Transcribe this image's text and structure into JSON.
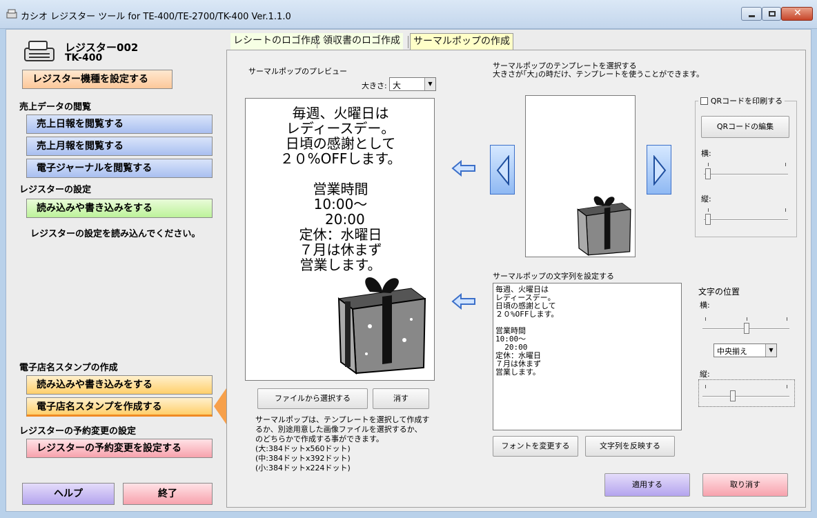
{
  "window": {
    "title": "カシオ レジスター ツール for TE-400/TE-2700/TK-400 Ver.1.1.0"
  },
  "left": {
    "register_name": "レジスター002",
    "register_model": "TK-400",
    "set_model_button": "レジスター機種を設定する",
    "sales_section": "売上データの閲覧",
    "daily_report_button": "売上日報を閲覧する",
    "monthly_report_button": "売上月報を閲覧する",
    "journal_button": "電子ジャーナルを閲覧する",
    "settings_section": "レジスターの設定",
    "read_write_button": "読み込みや書き込みをする",
    "settings_hint": "レジスターの設定を読み込んでください。",
    "stamp_section": "電子店名スタンプの作成",
    "stamp_read_write_button": "読み込みや書き込みをする",
    "stamp_create_button": "電子店名スタンプを作成する",
    "reservation_section": "レジスターの予約変更の設定",
    "reservation_button": "レジスターの予約変更を設定する",
    "help_button": "ヘルプ",
    "exit_button": "終了"
  },
  "tabs": [
    {
      "label": "レシートのロゴ作成",
      "active": false
    },
    {
      "label": "領収書のロゴ作成",
      "active": false
    },
    {
      "label": "サーマルポップの作成",
      "active": true
    }
  ],
  "preview": {
    "heading": "サーマルポップのプレビュー",
    "size_label": "大きさ:",
    "size_value": "大",
    "lines": [
      "毎週、火曜日は",
      "レディースデー。",
      "日頃の感謝として",
      "２０%OFFします。",
      "",
      "営業時間",
      "10:00～",
      "  20:00",
      "定休：水曜日",
      "７月は休まず",
      "営業します。"
    ],
    "select_file_button": "ファイルから選択する",
    "clear_button": "消す",
    "notes": [
      "サーマルポップは、テンプレートを選択して作成す",
      "るか、別途用意した画像ファイルを選択するか、",
      "のどちらかで作成する事ができます。",
      "(大:384ドットx560ドット)",
      "(中:384ドットx392ドット)",
      "(小:384ドットx224ドット)"
    ]
  },
  "template": {
    "heading1": "サーマルポップのテンプレートを選択する",
    "heading2": "大きさが｢大｣の時だけ、テンプレートを使うことができます。"
  },
  "qr": {
    "print_label": "QRコードを印刷する",
    "edit_button": "QRコードの編集",
    "horizontal_label": "横:",
    "vertical_label": "縦:"
  },
  "text_setting": {
    "heading": "サーマルポップの文字列を設定する",
    "content": "毎週、火曜日は\nレディースデー。\n日頃の感謝として\n２０%OFFします。\n\n営業時間\n10:00～\n  20:00\n定休：水曜日\n７月は休まず\n営業します。",
    "font_button": "フォントを変更する",
    "apply_text_button": "文字列を反映する"
  },
  "position": {
    "heading": "文字の位置",
    "horizontal_label": "横:",
    "align_value": "中央揃え",
    "vertical_label": "縦:"
  },
  "footer": {
    "apply_button": "適用する",
    "cancel_button": "取り消す"
  }
}
